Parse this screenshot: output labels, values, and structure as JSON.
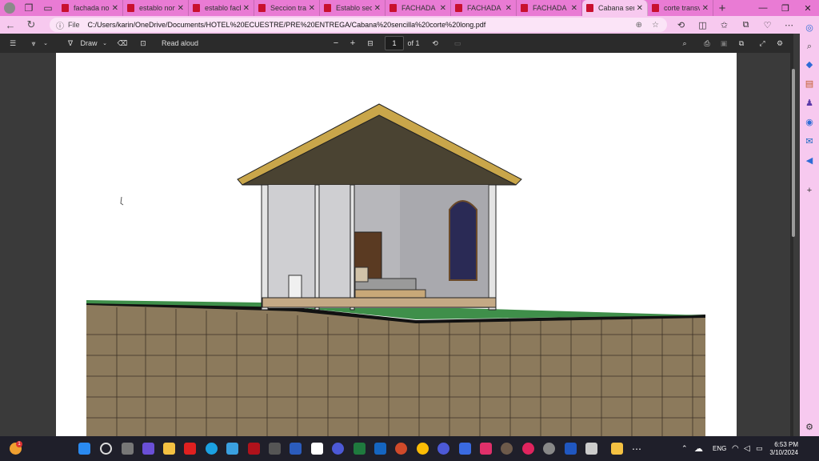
{
  "browser": {
    "tabs": [
      {
        "title": "fachada norte",
        "active": false
      },
      {
        "title": "establo norte",
        "active": false
      },
      {
        "title": "establo fachada",
        "active": false
      },
      {
        "title": "Seccion transv",
        "active": false
      },
      {
        "title": "Establo seccion",
        "active": false
      },
      {
        "title": "FACHADA NORTE",
        "active": false
      },
      {
        "title": "FACHADA NORTE",
        "active": false
      },
      {
        "title": "FACHADA OESTE",
        "active": false
      },
      {
        "title": "Cabana sencilla",
        "active": true
      },
      {
        "title": "corte transv",
        "active": false
      }
    ],
    "address_label": "File",
    "url": "C:/Users/karin/OneDrive/Documents/HOTEL%20ECUESTRE/PRE%20ENTREGA/Cabana%20sencilla%20corte%20long.pdf",
    "accent_color": "#e97bd4"
  },
  "pdf_toolbar": {
    "draw_label": "Draw",
    "read_aloud_label": "Read aloud",
    "page_current": "1",
    "page_total": "of 1"
  },
  "taskbar": {
    "notification_badge": "1",
    "language": "ENG",
    "time": "6:53 PM",
    "date": "3/10/2024"
  }
}
